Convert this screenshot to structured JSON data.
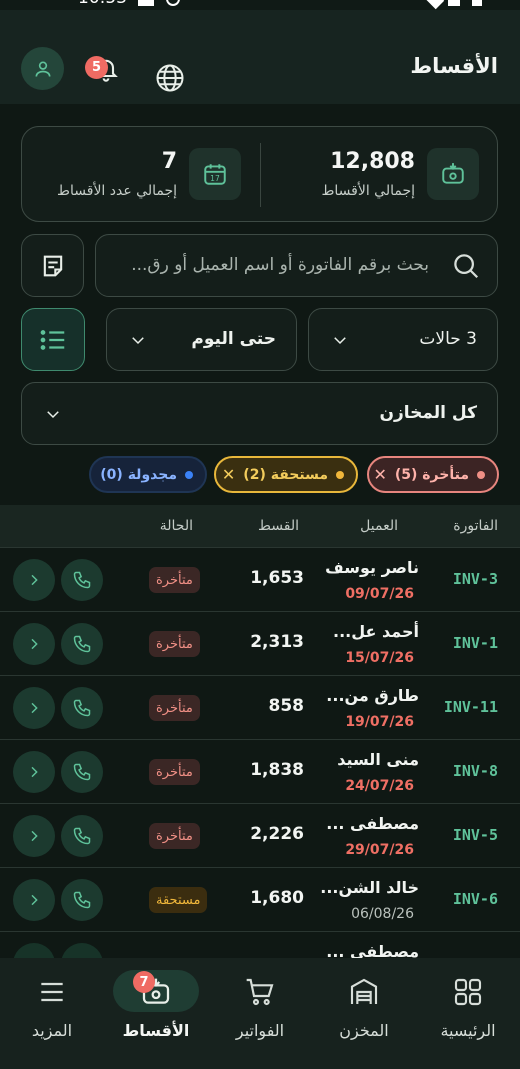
{
  "status_bar": {
    "time": "10:53"
  },
  "header": {
    "title": "الأقساط",
    "notifications_badge": "5"
  },
  "summary": {
    "total_installments_value": "12,808",
    "total_installments_label": "إجمالي الأقساط",
    "total_count_value": "7",
    "total_count_label": "إجمالي عدد الأقساط",
    "calendar_icon_day": "17"
  },
  "search": {
    "placeholder": "بحث برقم الفاتورة أو اسم العميل أو رق..."
  },
  "filters": {
    "status_dropdown": "3 حالات",
    "date_dropdown": "حتى اليوم",
    "warehouse_dropdown": "كل المخازن"
  },
  "chips": {
    "overdue": "متأخرة (5)",
    "due": "مستحقة (2)",
    "scheduled": "مجدولة (0)"
  },
  "table": {
    "headers": {
      "invoice": "الفاتورة",
      "customer": "العميل",
      "installment": "القسط",
      "status": "الحالة"
    },
    "rows": [
      {
        "invoice": "INV-3",
        "customer": "ناصر يوسف",
        "date": "09/07/26",
        "amount": "1,653",
        "status": "متأخرة"
      },
      {
        "invoice": "INV-1",
        "customer": "أحمد عل...",
        "date": "15/07/26",
        "amount": "2,313",
        "status": "متأخرة"
      },
      {
        "invoice": "INV-11",
        "customer": "طارق من...",
        "date": "19/07/26",
        "amount": "858",
        "status": "متأخرة"
      },
      {
        "invoice": "INV-8",
        "customer": "منى السيد",
        "date": "24/07/26",
        "amount": "1,838",
        "status": "متأخرة"
      },
      {
        "invoice": "INV-5",
        "customer": "مصطفى ...",
        "date": "29/07/26",
        "amount": "2,226",
        "status": "متأخرة"
      },
      {
        "invoice": "INV-6",
        "customer": "خالد الشن...",
        "date": "06/08/26",
        "amount": "1,680",
        "status": "مستحقة"
      },
      {
        "invoice": "",
        "customer": "مصطفى ...",
        "date": "",
        "amount": "",
        "status": ""
      }
    ]
  },
  "bottom_nav": {
    "home": "الرئيسية",
    "warehouse": "المخزن",
    "invoices": "الفواتير",
    "installments": "الأقساط",
    "installments_badge": "7",
    "more": "المزيد"
  },
  "colors": {
    "accent_green": "#5fc29a",
    "overdue_red": "#ef6f64",
    "due_amber": "#f0b73b",
    "scheduled_blue": "#8ab3ff",
    "background": "#0f1814"
  }
}
